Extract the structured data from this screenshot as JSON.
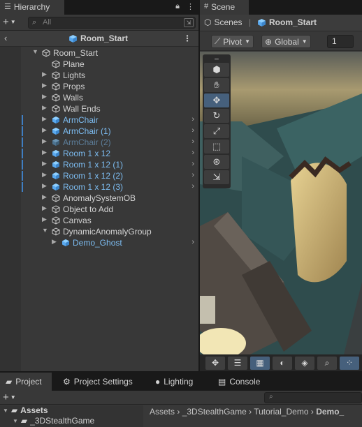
{
  "hierarchy": {
    "tab_label": "Hierarchy",
    "search_placeholder": "All",
    "header_title": "Room_Start",
    "rows": [
      {
        "label": "Room_Start",
        "depth": 0,
        "expand": "open",
        "style": "normal",
        "blue": false,
        "chevron": false
      },
      {
        "label": "Plane",
        "depth": 1,
        "expand": "none",
        "style": "normal",
        "blue": false,
        "chevron": false
      },
      {
        "label": "Lights",
        "depth": 1,
        "expand": "closed",
        "style": "normal",
        "blue": false,
        "chevron": false
      },
      {
        "label": "Props",
        "depth": 1,
        "expand": "closed",
        "style": "normal",
        "blue": false,
        "chevron": false
      },
      {
        "label": "Walls",
        "depth": 1,
        "expand": "closed",
        "style": "normal",
        "blue": false,
        "chevron": false
      },
      {
        "label": "Wall Ends",
        "depth": 1,
        "expand": "closed",
        "style": "normal",
        "blue": false,
        "chevron": false
      },
      {
        "label": "ArmChair",
        "depth": 1,
        "expand": "closed",
        "style": "prefab",
        "blue": true,
        "chevron": true
      },
      {
        "label": "ArmChair (1)",
        "depth": 1,
        "expand": "closed",
        "style": "prefab",
        "blue": true,
        "chevron": true
      },
      {
        "label": "ArmChair (2)",
        "depth": 1,
        "expand": "closed",
        "style": "prefab-dim",
        "blue": true,
        "chevron": true
      },
      {
        "label": "Room 1 x 12",
        "depth": 1,
        "expand": "closed",
        "style": "prefab",
        "blue": true,
        "chevron": true
      },
      {
        "label": "Room 1 x 12 (1)",
        "depth": 1,
        "expand": "closed",
        "style": "prefab",
        "blue": true,
        "chevron": true
      },
      {
        "label": "Room 1 x 12 (2)",
        "depth": 1,
        "expand": "closed",
        "style": "prefab",
        "blue": true,
        "chevron": true
      },
      {
        "label": "Room 1 x 12 (3)",
        "depth": 1,
        "expand": "closed",
        "style": "prefab",
        "blue": true,
        "chevron": true
      },
      {
        "label": "AnomalySystemOB",
        "depth": 1,
        "expand": "closed",
        "style": "normal",
        "blue": false,
        "chevron": false
      },
      {
        "label": "Object to Add",
        "depth": 1,
        "expand": "closed",
        "style": "normal",
        "blue": false,
        "chevron": false
      },
      {
        "label": "Canvas",
        "depth": 1,
        "expand": "closed",
        "style": "normal",
        "blue": false,
        "chevron": false
      },
      {
        "label": "DynamicAnomalyGroup",
        "depth": 1,
        "expand": "open",
        "style": "normal",
        "blue": false,
        "chevron": false
      },
      {
        "label": "Demo_Ghost",
        "depth": 2,
        "expand": "closed",
        "style": "prefab",
        "blue": false,
        "chevron": true
      }
    ]
  },
  "scene": {
    "tab_label": "Scene",
    "scenes_label": "Scenes",
    "scene_name": "Room_Start",
    "pivot_label": "Pivot",
    "global_label": "Global",
    "grid_value": "1"
  },
  "project": {
    "tabs": [
      {
        "label": "Project",
        "icon": "folder-icon"
      },
      {
        "label": "Project Settings",
        "icon": "gear-icon"
      },
      {
        "label": "Lighting",
        "icon": "bulb-icon"
      },
      {
        "label": "Console",
        "icon": "console-icon"
      }
    ],
    "assets_label": "Assets",
    "subfolder_label": "_3DStealthGame",
    "breadcrumb": [
      "Assets",
      "_3DStealthGame",
      "Tutorial_Demo",
      "Demo_"
    ]
  },
  "colors": {
    "prefab": "#7dbdf2",
    "selection_bar": "#3f7ec2",
    "active_tool": "#46607c"
  }
}
